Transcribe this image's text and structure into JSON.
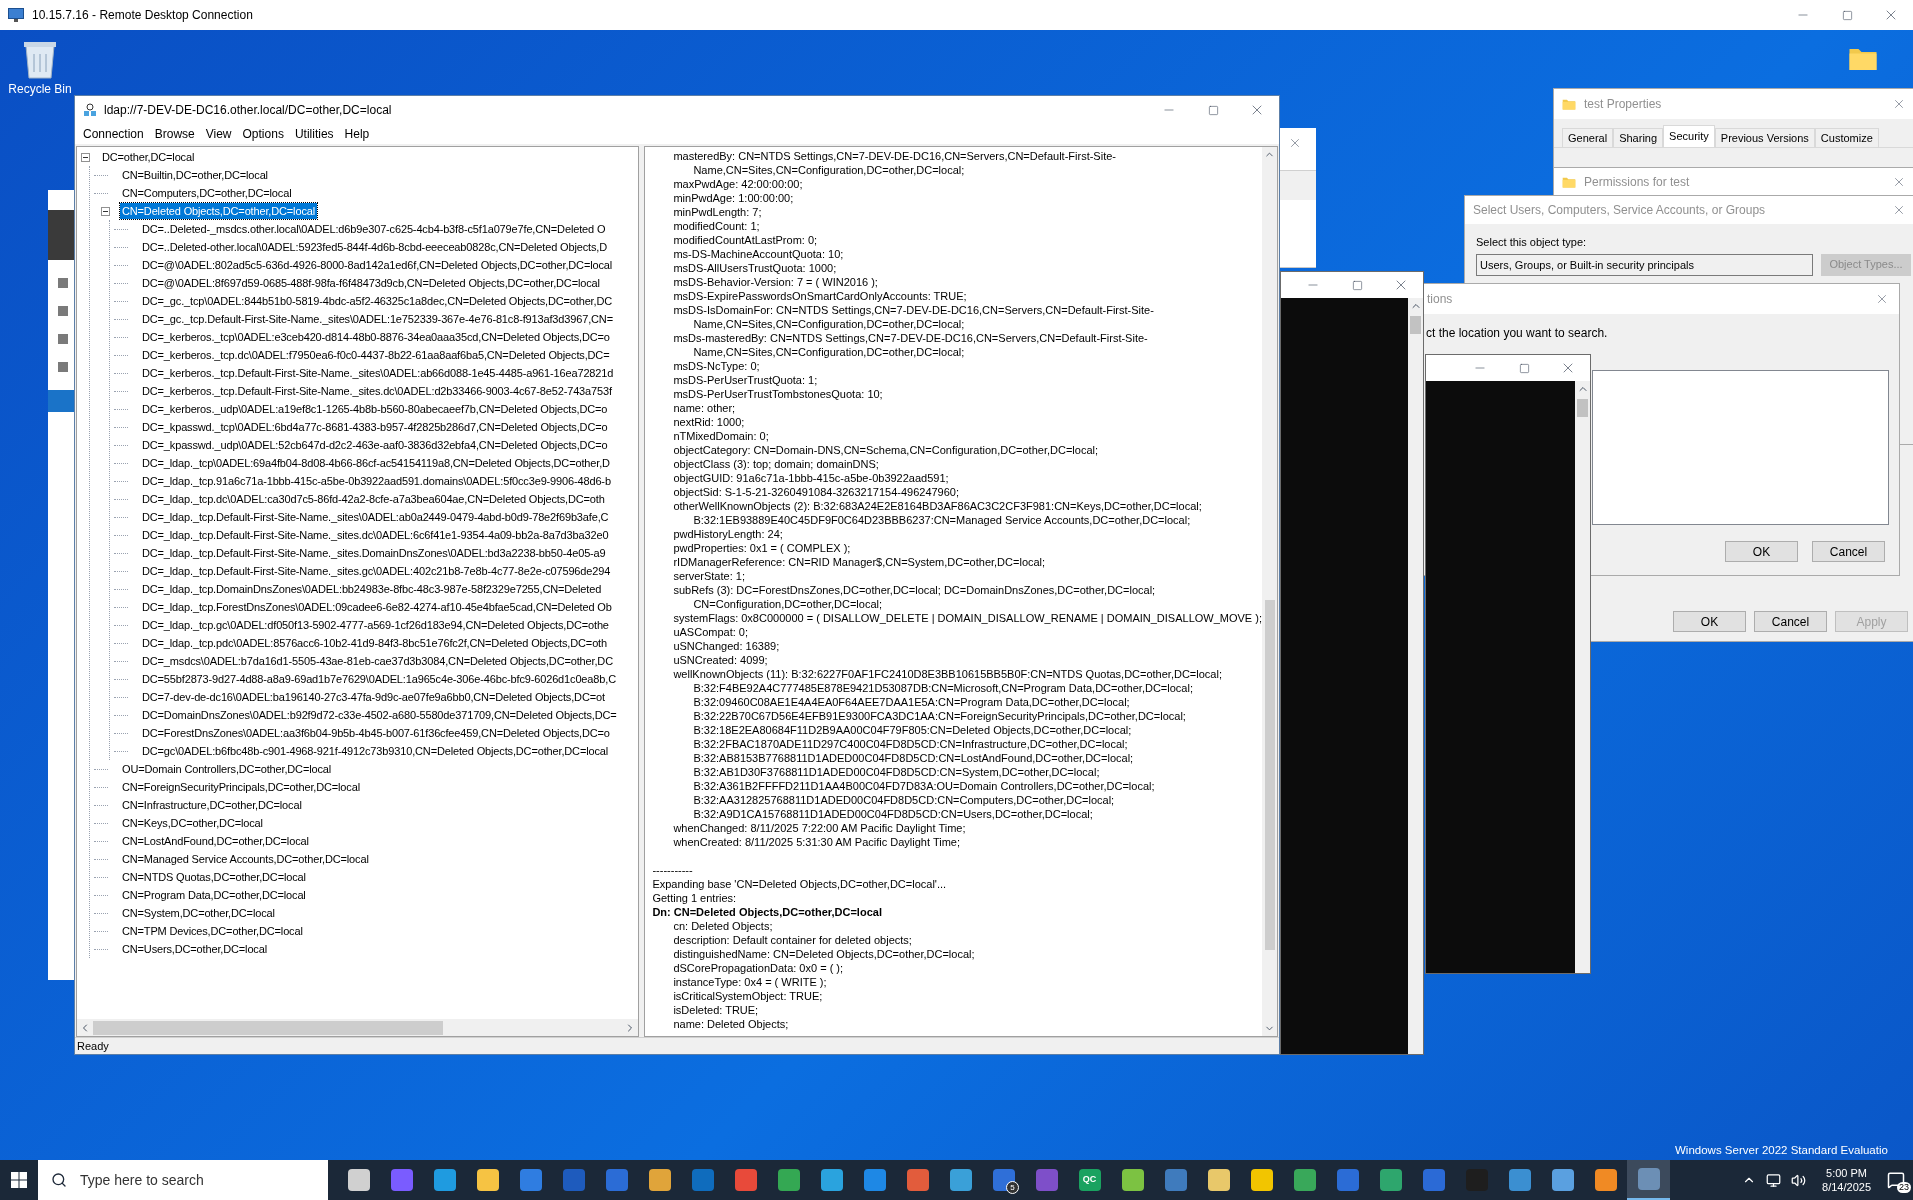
{
  "rdp_window": {
    "title": "10.15.7.16 - Remote Desktop Connection"
  },
  "desktop": {
    "recycle_bin_label": "Recycle Bin",
    "edition_text": "Windows Server 2022 Standard Evaluatio"
  },
  "ldp_window": {
    "title": "ldap://7-DEV-DE-DC16.other.local/DC=other,DC=local",
    "menu": [
      "Connection",
      "Browse",
      "View",
      "Options",
      "Utilities",
      "Help"
    ],
    "tree": [
      {
        "label": "DC=other,DC=local",
        "selected": false,
        "expanded": true,
        "children": [
          {
            "label": "CN=Builtin,DC=other,DC=local",
            "selected": false
          },
          {
            "label": "CN=Computers,DC=other,DC=local",
            "selected": false
          },
          {
            "label": "CN=Deleted Objects,DC=other,DC=local",
            "selected": true,
            "expanded": true,
            "children": [
              {
                "label": "DC=..Deleted-_msdcs.other.local\\0ADEL:d6b9e307-c625-4cb4-b3f8-c5f1a079e7fe,CN=Deleted O",
                "selected": false
              },
              {
                "label": "DC=..Deleted-other.local\\0ADEL:5923fed5-844f-4d6b-8cbd-eeeceab0828c,CN=Deleted Objects,D",
                "selected": false
              },
              {
                "label": "DC=@\\0ADEL:802ad5c5-636d-4926-8000-8ad142a1ed6f,CN=Deleted Objects,DC=other,DC=local",
                "selected": false
              },
              {
                "label": "DC=@\\0ADEL:8f697d59-0685-488f-98fa-f6f48473d9cb,CN=Deleted Objects,DC=other,DC=local",
                "selected": false
              },
              {
                "label": "DC=_gc._tcp\\0ADEL:844b51b0-5819-4bdc-a5f2-46325c1a8dec,CN=Deleted Objects,DC=other,DC",
                "selected": false
              },
              {
                "label": "DC=_gc._tcp.Default-First-Site-Name._sites\\0ADEL:1e752339-367e-4e76-81c8-f913af3d3967,CN=",
                "selected": false
              },
              {
                "label": "DC=_kerberos._tcp\\0ADEL:e3ceb420-d814-48b0-8876-34ea0aaa35cd,CN=Deleted Objects,DC=o",
                "selected": false
              },
              {
                "label": "DC=_kerberos._tcp.dc\\0ADEL:f7950ea6-f0c0-4437-8b22-61aa8aaf6ba5,CN=Deleted Objects,DC=",
                "selected": false
              },
              {
                "label": "DC=_kerberos._tcp.Default-First-Site-Name._sites\\0ADEL:ab66d088-1e45-4485-a961-16ea72821d",
                "selected": false
              },
              {
                "label": "DC=_kerberos._tcp.Default-First-Site-Name._sites.dc\\0ADEL:d2b33466-9003-4c67-8e52-743a753f",
                "selected": false
              },
              {
                "label": "DC=_kerberos._udp\\0ADEL:a19ef8c1-1265-4b8b-b560-80abecaeef7b,CN=Deleted Objects,DC=o",
                "selected": false
              },
              {
                "label": "DC=_kpasswd._tcp\\0ADEL:6bd4a77c-8681-4383-b957-4f2825b286d7,CN=Deleted Objects,DC=o",
                "selected": false
              },
              {
                "label": "DC=_kpasswd._udp\\0ADEL:52cb647d-d2c2-463e-aaf0-3836d32ebfa4,CN=Deleted Objects,DC=o",
                "selected": false
              },
              {
                "label": "DC=_ldap._tcp\\0ADEL:69a4fb04-8d08-4b66-86cf-ac54154119a8,CN=Deleted Objects,DC=other,D",
                "selected": false
              },
              {
                "label": "DC=_ldap._tcp.91a6c71a-1bbb-415c-a5be-0b3922aad591.domains\\0ADEL:5f0cc3e9-9906-48d6-b",
                "selected": false
              },
              {
                "label": "DC=_ldap._tcp.dc\\0ADEL:ca30d7c5-86fd-42a2-8cfe-a7a3bea604ae,CN=Deleted Objects,DC=oth",
                "selected": false
              },
              {
                "label": "DC=_ldap._tcp.Default-First-Site-Name._sites\\0ADEL:ab0a2449-0479-4abd-b0d9-78e2f69b3afe,C",
                "selected": false
              },
              {
                "label": "DC=_ldap._tcp.Default-First-Site-Name._sites.dc\\0ADEL:6c6f41e1-9354-4a09-bb2a-8a7d3ba32e0",
                "selected": false
              },
              {
                "label": "DC=_ldap._tcp.Default-First-Site-Name._sites.DomainDnsZones\\0ADEL:bd3a2238-bb50-4e05-a9",
                "selected": false
              },
              {
                "label": "DC=_ldap._tcp.Default-First-Site-Name._sites.gc\\0ADEL:402c21b8-7e8b-4c77-8e2e-c07596de294",
                "selected": false
              },
              {
                "label": "DC=_ldap._tcp.DomainDnsZones\\0ADEL:bb24983e-8fbc-48c3-987e-58f2329e7255,CN=Deleted",
                "selected": false
              },
              {
                "label": "DC=_ldap._tcp.ForestDnsZones\\0ADEL:09cadee6-6e82-4274-af10-45e4bfae5cad,CN=Deleted Ob",
                "selected": false
              },
              {
                "label": "DC=_ldap._tcp.gc\\0ADEL:df050f13-5902-4777-a569-1cf26d183e94,CN=Deleted Objects,DC=othe",
                "selected": false
              },
              {
                "label": "DC=_ldap._tcp.pdc\\0ADEL:8576acc6-10b2-41d9-84f3-8bc51e76fc2f,CN=Deleted Objects,DC=oth",
                "selected": false
              },
              {
                "label": "DC=_msdcs\\0ADEL:b7da16d1-5505-43ae-81eb-cae37d3b3084,CN=Deleted Objects,DC=other,DC",
                "selected": false
              },
              {
                "label": "DC=55bf2873-9d27-4d88-a8a9-69ad1b7e7629\\0ADEL:1a965c4e-306e-46bc-bfc9-6026d1c0ea8b,C",
                "selected": false
              },
              {
                "label": "DC=7-dev-de-dc16\\0ADEL:ba196140-27c3-47fa-9d9c-ae07fe9a6bb0,CN=Deleted Objects,DC=ot",
                "selected": false
              },
              {
                "label": "DC=DomainDnsZones\\0ADEL:b92f9d72-c33e-4502-a680-5580de371709,CN=Deleted Objects,DC=",
                "selected": false
              },
              {
                "label": "DC=ForestDnsZones\\0ADEL:aa3f6b04-9b5b-4b45-b007-61f36cfee459,CN=Deleted Objects,DC=o",
                "selected": false
              },
              {
                "label": "DC=gc\\0ADEL:b6fbc48b-c901-4968-921f-4912c73b9310,CN=Deleted Objects,DC=other,DC=local",
                "selected": false
              }
            ]
          },
          {
            "label": "OU=Domain Controllers,DC=other,DC=local",
            "selected": false
          },
          {
            "label": "CN=ForeignSecurityPrincipals,DC=other,DC=local",
            "selected": false
          },
          {
            "label": "CN=Infrastructure,DC=other,DC=local",
            "selected": false
          },
          {
            "label": "CN=Keys,DC=other,DC=local",
            "selected": false
          },
          {
            "label": "CN=LostAndFound,DC=other,DC=local",
            "selected": false
          },
          {
            "label": "CN=Managed Service Accounts,DC=other,DC=local",
            "selected": false
          },
          {
            "label": "CN=NTDS Quotas,DC=other,DC=local",
            "selected": false
          },
          {
            "label": "CN=Program Data,DC=other,DC=local",
            "selected": false
          },
          {
            "label": "CN=System,DC=other,DC=local",
            "selected": false
          },
          {
            "label": "CN=TPM Devices,DC=other,DC=local",
            "selected": false
          },
          {
            "label": "CN=Users,DC=other,DC=local",
            "selected": false
          }
        ]
      }
    ],
    "output": [
      {
        "kind": "attr",
        "text": "masteredBy: CN=NTDS Settings,CN=7-DEV-DE-DC16,CN=Servers,CN=Default-First-Site-"
      },
      {
        "kind": "cont",
        "text": "Name,CN=Sites,CN=Configuration,DC=other,DC=local;"
      },
      {
        "kind": "attr",
        "text": "maxPwdAge: 42:00:00:00;"
      },
      {
        "kind": "attr",
        "text": "minPwdAge: 1:00:00:00;"
      },
      {
        "kind": "attr",
        "text": "minPwdLength: 7;"
      },
      {
        "kind": "attr",
        "text": "modifiedCount: 1;"
      },
      {
        "kind": "attr",
        "text": "modifiedCountAtLastProm: 0;"
      },
      {
        "kind": "attr",
        "text": "ms-DS-MachineAccountQuota: 10;"
      },
      {
        "kind": "attr",
        "text": "msDS-AllUsersTrustQuota: 1000;"
      },
      {
        "kind": "attr",
        "text": "msDS-Behavior-Version: 7 = ( WIN2016 );"
      },
      {
        "kind": "attr",
        "text": "msDS-ExpirePasswordsOnSmartCardOnlyAccounts: TRUE;"
      },
      {
        "kind": "attr",
        "text": "msDS-IsDomainFor: CN=NTDS Settings,CN=7-DEV-DE-DC16,CN=Servers,CN=Default-First-Site-"
      },
      {
        "kind": "cont",
        "text": "Name,CN=Sites,CN=Configuration,DC=other,DC=local;"
      },
      {
        "kind": "attr",
        "text": "msDs-masteredBy: CN=NTDS Settings,CN=7-DEV-DE-DC16,CN=Servers,CN=Default-First-Site-"
      },
      {
        "kind": "cont",
        "text": "Name,CN=Sites,CN=Configuration,DC=other,DC=local;"
      },
      {
        "kind": "attr",
        "text": "msDS-NcType: 0;"
      },
      {
        "kind": "attr",
        "text": "msDS-PerUserTrustQuota: 1;"
      },
      {
        "kind": "attr",
        "text": "msDS-PerUserTrustTombstonesQuota: 10;"
      },
      {
        "kind": "attr",
        "text": "name: other;"
      },
      {
        "kind": "attr",
        "text": "nextRid: 1000;"
      },
      {
        "kind": "attr",
        "text": "nTMixedDomain: 0;"
      },
      {
        "kind": "attr",
        "text": "objectCategory: CN=Domain-DNS,CN=Schema,CN=Configuration,DC=other,DC=local;"
      },
      {
        "kind": "attr",
        "text": "objectClass (3): top; domain; domainDNS;"
      },
      {
        "kind": "attr",
        "text": "objectGUID: 91a6c71a-1bbb-415c-a5be-0b3922aad591;"
      },
      {
        "kind": "attr",
        "text": "objectSid: S-1-5-21-3260491084-3263217154-496247960;"
      },
      {
        "kind": "attr",
        "text": "otherWellKnownObjects (2): B:32:683A24E2E8164BD3AF86AC3C2CF3F981:CN=Keys,DC=other,DC=local;"
      },
      {
        "kind": "cont",
        "text": "B:32:1EB93889E40C45DF9F0C64D23BBB6237:CN=Managed Service Accounts,DC=other,DC=local;"
      },
      {
        "kind": "attr",
        "text": "pwdHistoryLength: 24;"
      },
      {
        "kind": "attr",
        "text": "pwdProperties: 0x1 = ( COMPLEX );"
      },
      {
        "kind": "attr",
        "text": "rIDManagerReference: CN=RID Manager$,CN=System,DC=other,DC=local;"
      },
      {
        "kind": "attr",
        "text": "serverState: 1;"
      },
      {
        "kind": "attr",
        "text": "subRefs (3): DC=ForestDnsZones,DC=other,DC=local; DC=DomainDnsZones,DC=other,DC=local;"
      },
      {
        "kind": "cont",
        "text": "CN=Configuration,DC=other,DC=local;"
      },
      {
        "kind": "attr",
        "text": "systemFlags: 0x8C000000 = ( DISALLOW_DELETE | DOMAIN_DISALLOW_RENAME | DOMAIN_DISALLOW_MOVE );"
      },
      {
        "kind": "attr",
        "text": "uASCompat: 0;"
      },
      {
        "kind": "attr",
        "text": "uSNChanged: 16389;"
      },
      {
        "kind": "attr",
        "text": "uSNCreated: 4099;"
      },
      {
        "kind": "attr",
        "text": "wellKnownObjects (11): B:32:6227F0AF1FC2410D8E3BB10615BB5B0F:CN=NTDS Quotas,DC=other,DC=local;"
      },
      {
        "kind": "cont",
        "text": "B:32:F4BE92A4C777485E878E9421D53087DB:CN=Microsoft,CN=Program Data,DC=other,DC=local;"
      },
      {
        "kind": "cont",
        "text": "B:32:09460C08AE1E4A4EA0F64AEE7DAA1E5A:CN=Program Data,DC=other,DC=local;"
      },
      {
        "kind": "cont",
        "text": "B:32:22B70C67D56E4EFB91E9300FCA3DC1AA:CN=ForeignSecurityPrincipals,DC=other,DC=local;"
      },
      {
        "kind": "cont",
        "text": "B:32:18E2EA80684F11D2B9AA00C04F79F805:CN=Deleted Objects,DC=other,DC=local;"
      },
      {
        "kind": "cont",
        "text": "B:32:2FBAC1870ADE11D297C400C04FD8D5CD:CN=Infrastructure,DC=other,DC=local;"
      },
      {
        "kind": "cont",
        "text": "B:32:AB8153B7768811D1ADED00C04FD8D5CD:CN=LostAndFound,DC=other,DC=local;"
      },
      {
        "kind": "cont",
        "text": "B:32:AB1D30F3768811D1ADED00C04FD8D5CD:CN=System,DC=other,DC=local;"
      },
      {
        "kind": "cont",
        "text": "B:32:A361B2FFFFD211D1AA4B00C04FD7D83A:OU=Domain Controllers,DC=other,DC=local;"
      },
      {
        "kind": "cont",
        "text": "B:32:AA312825768811D1ADED00C04FD8D5CD:CN=Computers,DC=other,DC=local;"
      },
      {
        "kind": "cont",
        "text": "B:32:A9D1CA15768811D1ADED00C04FD8D5CD:CN=Users,DC=other,DC=local;"
      },
      {
        "kind": "attr",
        "text": "whenChanged: 8/11/2025 7:22:00 AM Pacific Daylight Time;"
      },
      {
        "kind": "attr",
        "text": "whenCreated: 8/11/2025 5:31:30 AM Pacific Daylight Time;"
      },
      {
        "kind": "gap"
      },
      {
        "kind": "log",
        "text": "-----------"
      },
      {
        "kind": "log",
        "text": "Expanding base 'CN=Deleted Objects,DC=other,DC=local'..."
      },
      {
        "kind": "log",
        "text": "Getting 1 entries:"
      },
      {
        "kind": "heading",
        "text": "Dn: CN=Deleted Objects,DC=other,DC=local"
      },
      {
        "kind": "attr",
        "text": "cn: Deleted Objects;"
      },
      {
        "kind": "attr",
        "text": "description: Default container for deleted objects;"
      },
      {
        "kind": "attr",
        "text": "distinguishedName: CN=Deleted Objects,DC=other,DC=local;"
      },
      {
        "kind": "attr",
        "text": "dSCorePropagationData: 0x0 = (  );"
      },
      {
        "kind": "attr",
        "text": "instanceType: 0x4 = ( WRITE );"
      },
      {
        "kind": "attr",
        "text": "isCriticalSystemObject: TRUE;"
      },
      {
        "kind": "attr",
        "text": "isDeleted: TRUE;"
      },
      {
        "kind": "attr",
        "text": "name: Deleted Objects;"
      }
    ],
    "status": "Ready"
  },
  "properties_dialog": {
    "title": "test Properties",
    "tabs": [
      {
        "label": "General",
        "selected": false
      },
      {
        "label": "Sharing",
        "selected": false
      },
      {
        "label": "Security",
        "selected": true
      },
      {
        "label": "Previous Versions",
        "selected": false
      },
      {
        "label": "Customize",
        "selected": false
      }
    ]
  },
  "permissions_dialog": {
    "title": "Permissions for test",
    "buttons": [
      {
        "label": "OK",
        "disabled": false
      },
      {
        "label": "Cancel",
        "disabled": false
      },
      {
        "label": "Apply",
        "disabled": true
      }
    ]
  },
  "select_dialog": {
    "title": "Select Users, Computers, Service Accounts, or Groups",
    "object_type_label": "Select this object type:",
    "object_type_value": "Users, Groups, or Built-in security principals",
    "object_types_button": {
      "label": "Object Types...",
      "disabled": true
    }
  },
  "locations_dialog": {
    "title": "tions",
    "prompt": "ct the location you want to search.",
    "buttons": [
      {
        "label": "OK",
        "disabled": false
      },
      {
        "label": "Cancel",
        "disabled": false
      }
    ]
  },
  "taskbar": {
    "search_placeholder": "Type here to search",
    "time": "5:00 PM",
    "date": "8/14/2025",
    "notification_count": "23",
    "apps": [
      {
        "color": "#d0d0d0",
        "selected": false
      },
      {
        "color": "#7a5cff",
        "selected": false
      },
      {
        "color": "#1f9be0",
        "selected": false
      },
      {
        "color": "#f6c343",
        "selected": false
      },
      {
        "color": "#2f7de1",
        "selected": false
      },
      {
        "color": "#1e5bbd",
        "selected": false
      },
      {
        "color": "#2b6cd6",
        "selected": false
      },
      {
        "color": "#e0a43a",
        "selected": false
      },
      {
        "color": "#0f6cbd",
        "selected": false
      },
      {
        "color": "#e84a3a",
        "selected": false
      },
      {
        "color": "#34a853",
        "selected": false
      },
      {
        "color": "#2aa3de",
        "selected": false
      },
      {
        "color": "#1e88e5",
        "selected": false
      },
      {
        "color": "#e25c3c",
        "selected": false
      },
      {
        "color": "#3aa0d8",
        "selected": false
      },
      {
        "color": "#2f6fd8",
        "selected": false,
        "badge": "5"
      },
      {
        "color": "#7e4fc9",
        "selected": false
      },
      {
        "color": "#1aa260",
        "selected": false,
        "label": "QC"
      },
      {
        "color": "#7cc242",
        "selected": false
      },
      {
        "color": "#3f7bbd",
        "selected": false
      },
      {
        "color": "#e8c86a",
        "selected": false
      },
      {
        "color": "#f2c500",
        "selected": false
      },
      {
        "color": "#39a85a",
        "selected": false
      },
      {
        "color": "#2b6cd6",
        "selected": false
      },
      {
        "color": "#2ea66d",
        "selected": false
      },
      {
        "color": "#2b6ad6",
        "selected": false
      },
      {
        "color": "#1e1e1e",
        "selected": false
      },
      {
        "color": "#3b8fd1",
        "selected": false
      },
      {
        "color": "#5aa0e0",
        "selected": false
      },
      {
        "color": "#f08a24",
        "selected": false
      },
      {
        "color": "#6c8fb5",
        "selected": true
      }
    ]
  }
}
